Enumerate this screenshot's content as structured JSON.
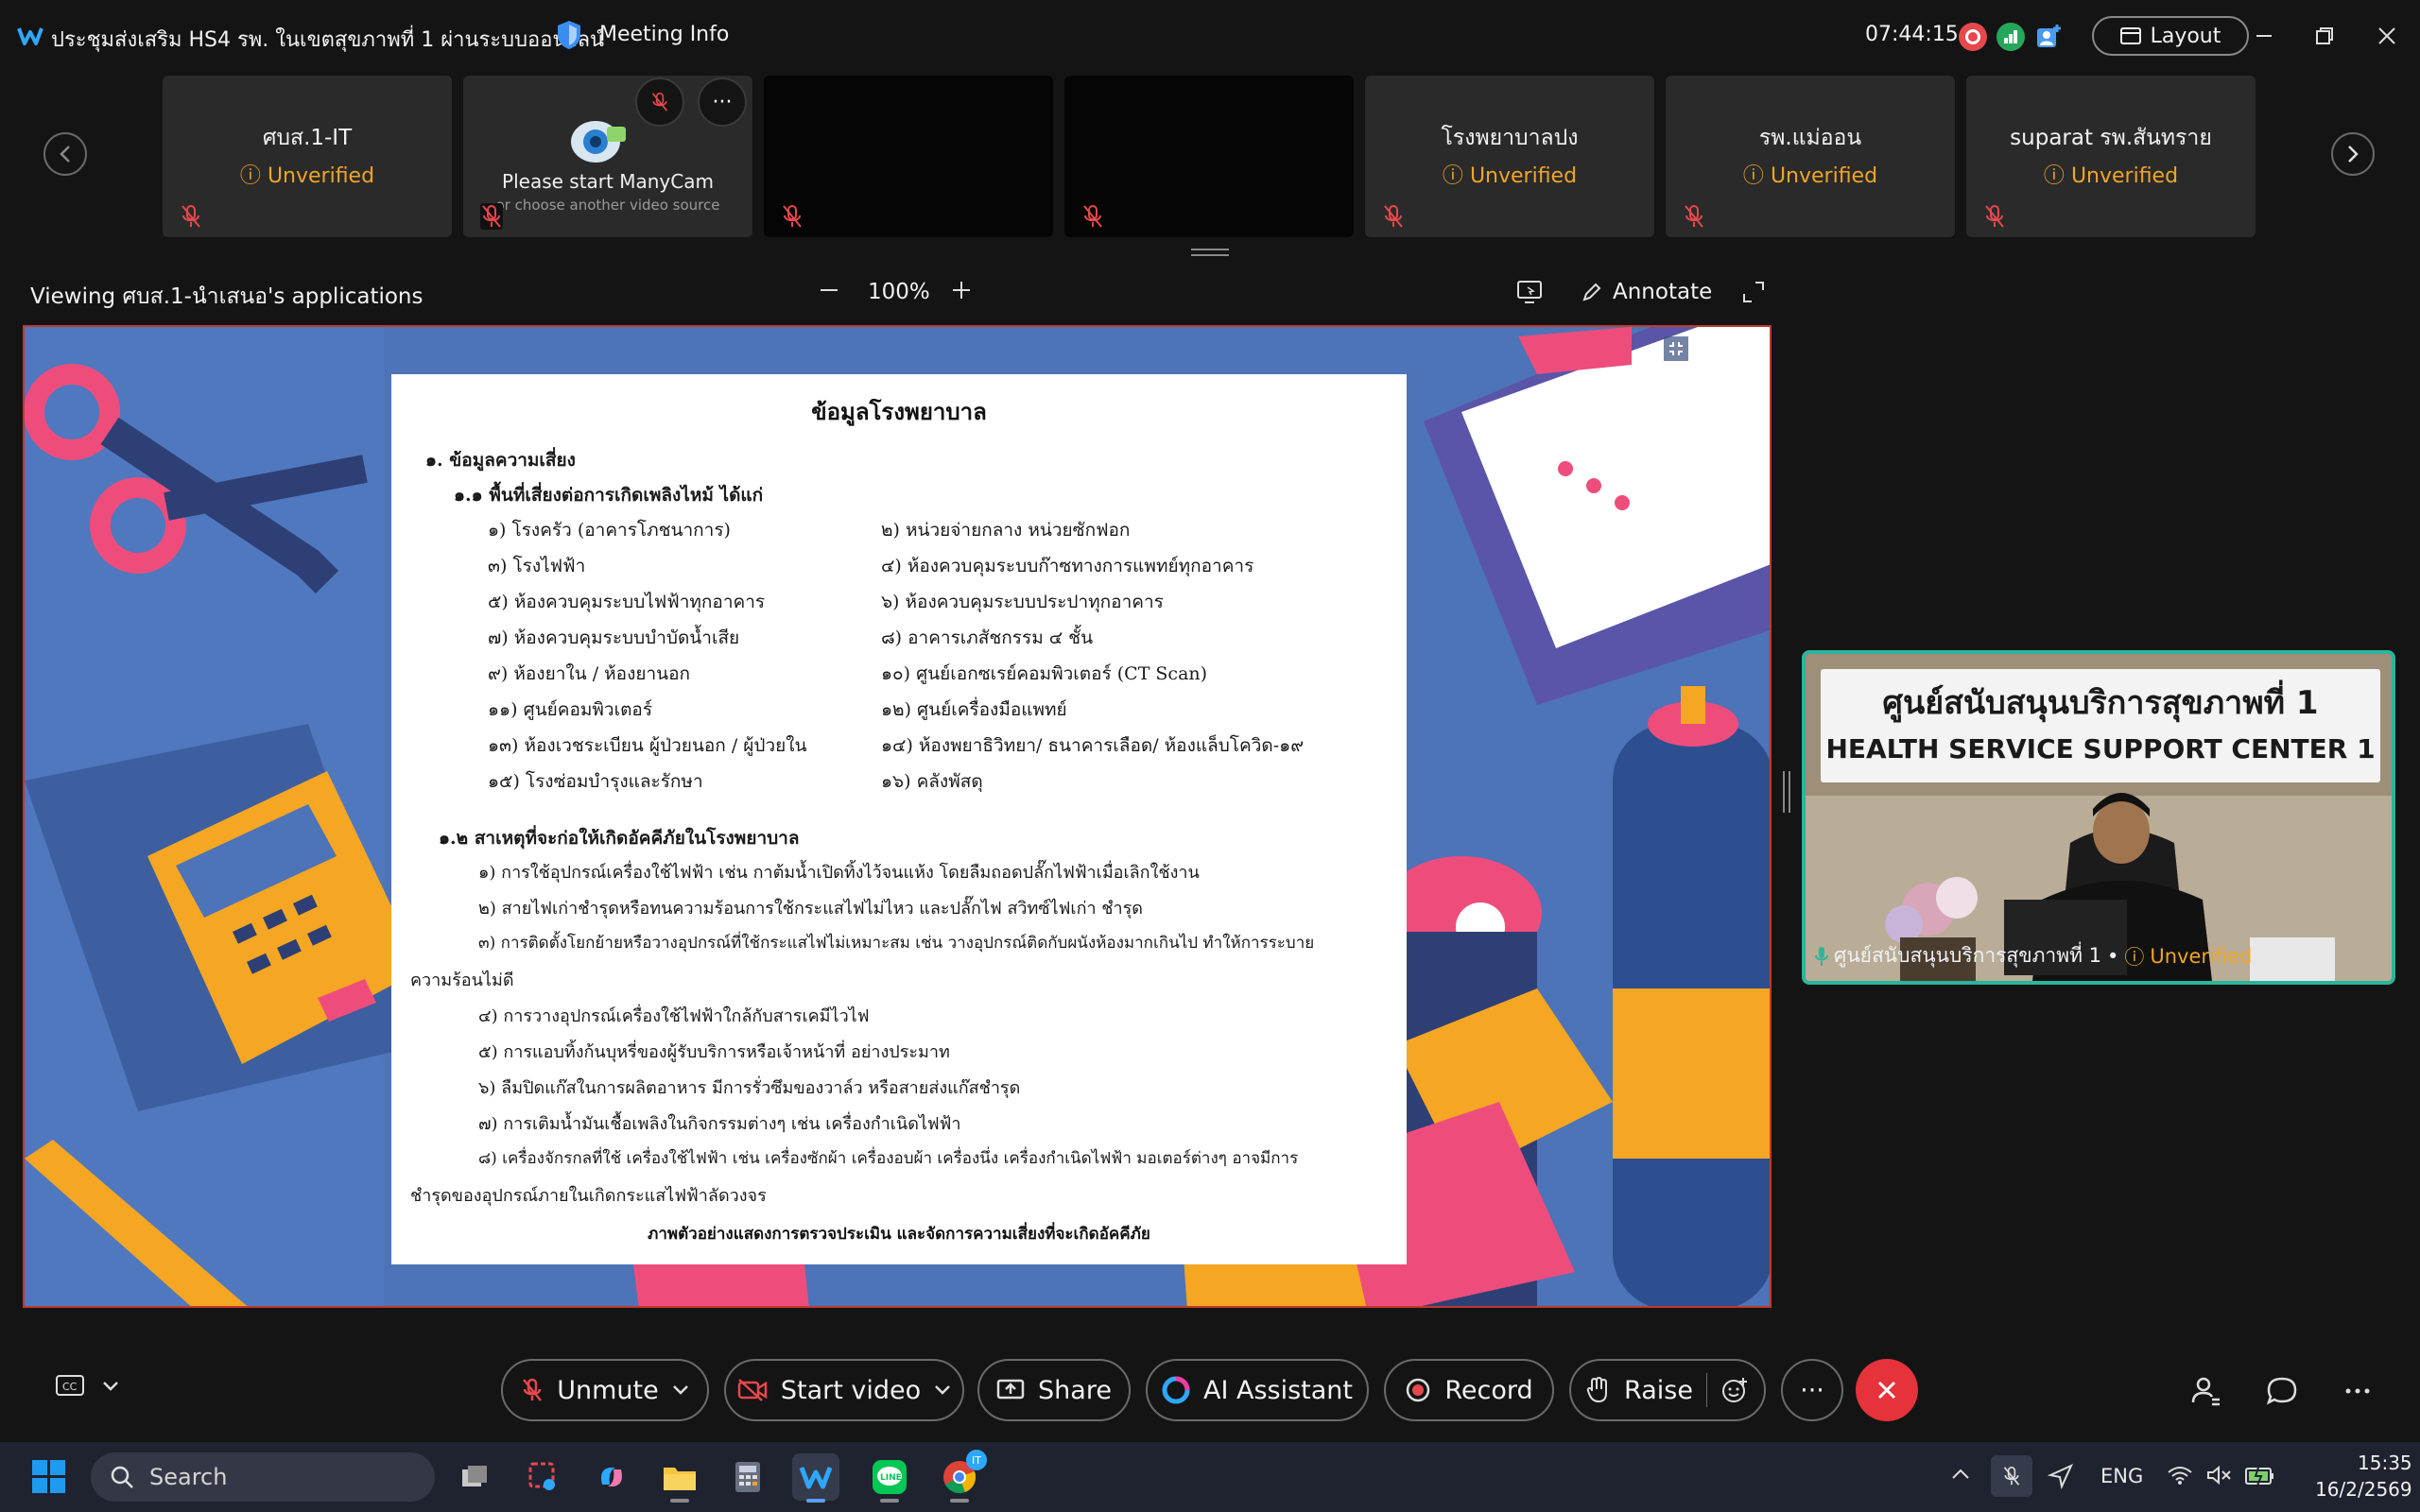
{
  "titlebar": {
    "meeting_title": "ประชุมส่งเสริม HS4 รพ. ในเขตสุขภาพที่ 1 ผ่านระบบออนไลน์",
    "meeting_info": "Meeting Info",
    "time": "07:44:15",
    "layout_label": "Layout"
  },
  "participants": [
    {
      "name": "ศบส.1-IT",
      "status": "Unverified"
    },
    {
      "name": "",
      "status": "",
      "video_text": "Please start ManyCam",
      "video_subtext": "or choose another video source"
    },
    {
      "name": "",
      "status": ""
    },
    {
      "name": "",
      "status": ""
    },
    {
      "name": "โรงพยาบาลปง",
      "status": "Unverified"
    },
    {
      "name": "รพ.แม่ออน",
      "status": "Unverified"
    },
    {
      "name": "suparat รพ.สันทราย",
      "status": "Unverified"
    }
  ],
  "participant_more": "···",
  "share": {
    "viewing": "Viewing ศบส.1-นำเสนอ's applications",
    "zoom": "100%",
    "annotate": "Annotate"
  },
  "document": {
    "title": "ข้อมูลโรงพยาบาล",
    "section1": "๑. ข้อมูลความเสี่ยง",
    "section1_1": "๑.๑ พื้นที่เสี่ยงต่อการเกิดเพลิงไหม้ ได้แก่",
    "risk_areas_left": [
      "๑) โรงครัว (อาคารโภชนาการ)",
      "๓) โรงไฟฟ้า",
      "๕) ห้องควบคุมระบบไฟฟ้าทุกอาคาร",
      "๗) ห้องควบคุมระบบบำบัดน้ำเสีย",
      "๙) ห้องยาใน / ห้องยานอก",
      "๑๑) ศูนย์คอมพิวเตอร์",
      "๑๓) ห้องเวชระเบียน ผู้ป่วยนอก / ผู้ป่วยใน",
      "๑๕) โรงซ่อมบำรุงและรักษา"
    ],
    "risk_areas_right": [
      "๒) หน่วยจ่ายกลาง หน่วยซักฟอก",
      "๔) ห้องควบคุมระบบก๊าซทางการแพทย์ทุกอาคาร",
      "๖) ห้องควบคุมระบบประปาทุกอาคาร",
      "๘) อาคารเภสัชกรรม ๔ ชั้น",
      "๑๐) ศูนย์เอกซเรย์คอมพิวเตอร์ (CT Scan)",
      "๑๒) ศูนย์เครื่องมือแพทย์",
      "๑๔) ห้องพยาธิวิทยา/ ธนาคารเลือด/ ห้องแล็บโควิด-๑๙",
      "๑๖) คลังพัสดุ"
    ],
    "section1_2": "๑.๒ สาเหตุที่จะก่อให้เกิดอัคคีภัยในโรงพยาบาล",
    "causes": [
      "๑) การใช้อุปกรณ์เครื่องใช้ไฟฟ้า เช่น กาต้มน้ำเปิดทิ้งไว้จนแห้ง โดยลืมถอดปลั๊กไฟฟ้าเมื่อเลิกใช้งาน",
      "๒) สายไฟเก่าชำรุดหรือทนความร้อนการใช้กระแสไฟไม่ไหว และปลั๊กไฟ สวิทซ์ไฟเก่า ชำรุด",
      "๓) การติดตั้งโยกย้ายหรือวางอุปกรณ์ที่ใช้กระแสไฟไม่เหมาะสม เช่น วางอุปกรณ์ติดกับผนังห้องมากเกินไป ทำให้การระบาย",
      "ความร้อนไม่ดี",
      "๔) การวางอุปกรณ์เครื่องใช้ไฟฟ้าใกล้กับสารเคมีไวไฟ",
      "๕) การแอบทิ้งก้นบุหรี่ของผู้รับบริการหรือเจ้าหน้าที่ อย่างประมาท",
      "๖) ลืมปิดแก๊สในการผลิตอาหาร มีการรั่วซึมของวาล์ว หรือสายส่งแก๊สชำรุด",
      "๗) การเติมน้ำมันเชื้อเพลิงในกิจกรรมต่างๆ เช่น เครื่องกำเนิดไฟฟ้า",
      "๘) เครื่องจักรกลที่ใช้ เครื่องใช้ไฟฟ้า เช่น เครื่องซักผ้า เครื่องอบผ้า เครื่องนึ่ง เครื่องกำเนิดไฟฟ้า มอเตอร์ต่างๆ อาจมีการ",
      "ชำรุดของอุปกรณ์ภายในเกิดกระแสไฟฟ้าลัดวงจร"
    ],
    "caption": "ภาพตัวอย่างแสดงการตรวจประเมิน และจัดการความเสี่ยงที่จะเกิดอัคคีภัย"
  },
  "speaker": {
    "sign_th": "ศูนย์สนับสนุนบริการสุขภาพที่ 1",
    "sign_en": "HEALTH SERVICE SUPPORT CENTER 1",
    "name": "ศูนย์สนับสนุนบริการสุขภาพที่ 1",
    "separator": "•",
    "status": "Unverified"
  },
  "controls": {
    "unmute": "Unmute",
    "start_video": "Start video",
    "share": "Share",
    "ai_assistant": "AI Assistant",
    "record": "Record",
    "raise": "Raise",
    "more": "···"
  },
  "taskbar": {
    "search": "Search",
    "language": "ENG",
    "time": "15:35",
    "date": "16/2/2569",
    "chrome_badge": "IT"
  },
  "colors": {
    "unverified": "#f0a528",
    "end_call": "#e5323b",
    "speaker_border": "#2bb59a",
    "share_border": "#c0392b"
  }
}
